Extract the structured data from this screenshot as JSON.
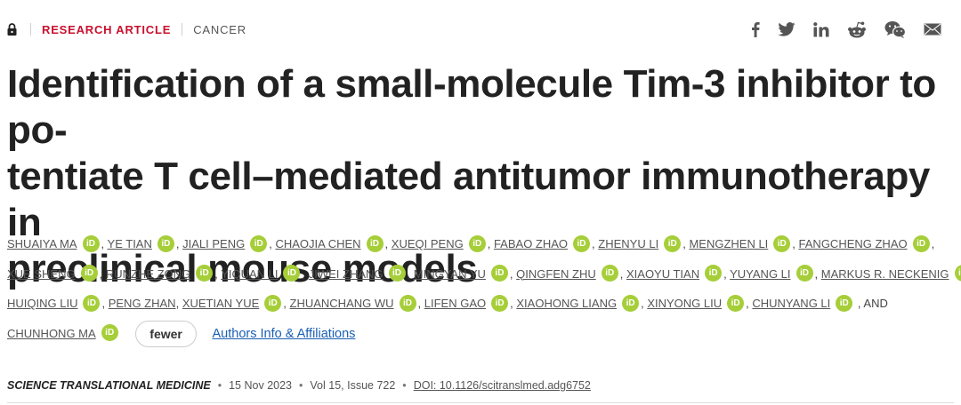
{
  "header": {
    "article_type": "RESEARCH ARTICLE",
    "subject": "CANCER",
    "share_icons": [
      "facebook-icon",
      "twitter-icon",
      "linkedin-icon",
      "reddit-icon",
      "wechat-icon",
      "email-icon"
    ]
  },
  "title": {
    "line1": "Identification of a small-molecule Tim-3 inhibitor to po-",
    "line2": "tentiate T cell–mediated antitumor immunotherapy in",
    "line3": "preclinical mouse models"
  },
  "authors": {
    "items": [
      "SHUAIYA MA",
      "YE TIAN",
      "JIALI PENG",
      "CHAOJIA CHEN",
      "XUEQI PENG",
      "FABAO ZHAO",
      "ZHENYU LI",
      "MENGZHEN LI",
      "FANGCHENG ZHAO",
      "XUE SHENG",
      "RUNZHE ZONG",
      "YIQUAN LI",
      "JIWEI ZHANG",
      "MINGYAN YU",
      "QINGFEN ZHU",
      "XIAOYU TIAN",
      "YUYANG LI",
      "MARKUS R. NECKENIG",
      "HUIQING LIU",
      "PENG ZHAN",
      "XUETIAN YUE",
      "ZHUANCHANG WU",
      "LIFEN GAO",
      "XIAOHONG LIANG",
      "XINYONG LIU",
      "CHUNYANG LI",
      "CHUNHONG MA"
    ],
    "orcid_label": "iD",
    "comma": ",",
    "and_text": ", AND",
    "fewer_label": "fewer",
    "affiliations_label": "Authors Info & Affiliations"
  },
  "meta": {
    "journal": "SCIENCE TRANSLATIONAL MEDICINE",
    "bullet": "•",
    "date": "15 Nov 2023",
    "volume": "Vol 15, Issue 722",
    "doi": "DOI: 10.1126/scitranslmed.adg6752"
  }
}
